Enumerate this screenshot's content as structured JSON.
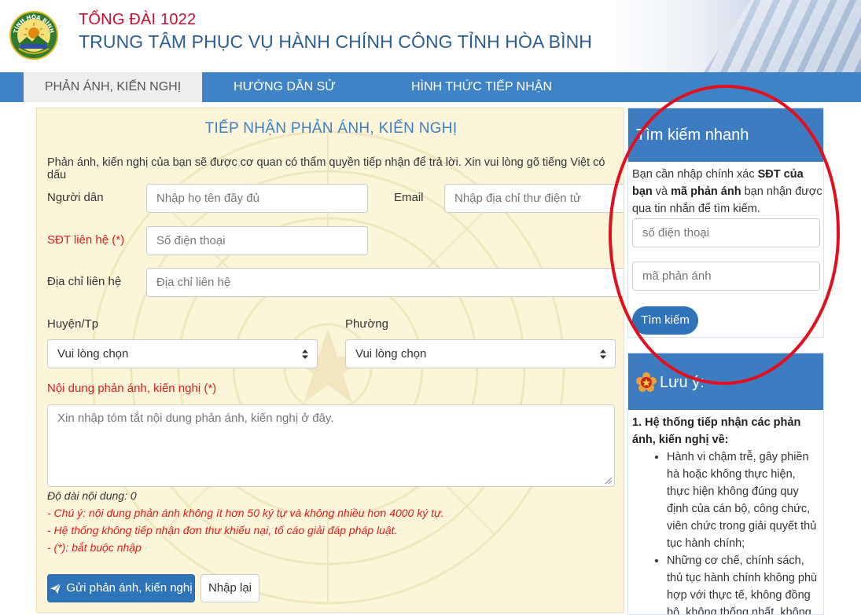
{
  "header": {
    "hotline": "TỔNG ĐÀI 1022",
    "title": "TRUNG TÂM PHỤC VỤ HÀNH CHÍNH CÔNG TỈNH HÒA BÌNH",
    "logo_text": "TỈNH HÒA BÌNH"
  },
  "nav": {
    "items": [
      {
        "label": "PHẢN ÁNH, KIẾN NGHỊ"
      },
      {
        "label": "HƯỚNG DẪN SỬ DỤNG"
      },
      {
        "label": "HÌNH THỨC TIẾP NHẬN"
      }
    ]
  },
  "form": {
    "title": "TIẾP NHẬN PHẢN ÁNH, KIẾN NGHỊ",
    "intro": "Phản ánh, kiến nghị của bạn sẽ được cơ quan có thẩm quyền tiếp nhận để trả lời. Xin vui lòng gõ tiếng Việt có dấu",
    "name_label": "Người dân",
    "name_placeholder": "Nhập họ tên đầy đủ",
    "email_label": "Email",
    "email_placeholder": "Nhập địa chỉ thư điện tử",
    "phone_label": "SĐT liên hệ (*)",
    "phone_placeholder": "Số điện thoại",
    "address_label": "Địa chỉ liên hệ",
    "address_placeholder": "Địa chỉ liên hệ",
    "district_label": "Huyện/Tp",
    "district_value": "Vui lòng chọn",
    "ward_label": "Phường",
    "ward_value": "Vui lòng chọn",
    "content_label": "Nội dung phản ánh, kiến nghị (*)",
    "content_placeholder": "Xin nhập tóm tắt nội dung phản ánh, kiến nghị ở đây.",
    "length_note": "Độ dài nội dung: 0",
    "notes": [
      "- Chú ý: nội dung phản ánh không ít hơn 50 ký tự và không nhiều hơn 4000 ký tự.",
      "- Hệ thống không tiếp nhận đơn thư khiếu nại, tố cáo giải đáp pháp luật.",
      "- (*): bắt buộc nhập"
    ],
    "submit_label": "Gửi phản ánh, kiến nghị",
    "reset_label": "Nhập lại"
  },
  "search": {
    "title": "Tìm kiếm nhanh",
    "desc_1": "Bạn cần nhập chính xác ",
    "desc_bold_1": "SĐT của bạn",
    "desc_2": " và ",
    "desc_bold_2": "mã phản ánh",
    "desc_3": " bạn nhận được qua tin nhắn để tìm kiếm.",
    "phone_placeholder": "số điện thoại",
    "code_placeholder": "mã phản ánh",
    "button_label": "Tìm kiếm"
  },
  "notice": {
    "title": "Lưu ý:",
    "heading": "1. Hệ thống tiếp nhận các phản ánh, kiến nghị về:",
    "items": [
      "Hành vi chậm trễ, gây phiền hà hoặc không thực hiện, thực hiện không đúng quy định của cán bộ, công chức, viên chức trong giải quyết thủ tục hành chính;",
      "Những cơ chế, chính sách, thủ tục hành chính không phù hợp với thực tế, không đồng bộ, không thống nhất, không hợp"
    ]
  },
  "colors": {
    "brand_blue": "#3d83c6",
    "hotline_red": "#c8102e",
    "form_bg": "#fdf5d9",
    "annotation_red": "#e0101e"
  }
}
